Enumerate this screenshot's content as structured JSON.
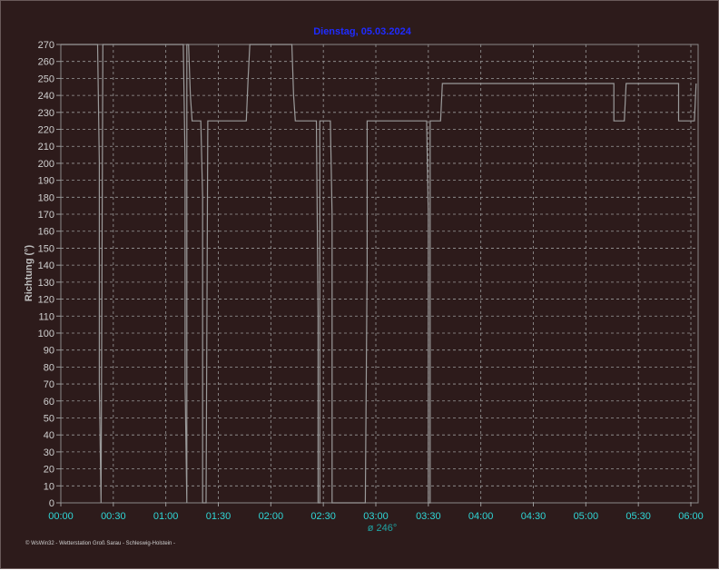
{
  "chart_data": {
    "type": "line",
    "title": "Dienstag, 05.03.2024",
    "ylabel": "Richtung  (°)",
    "ylim": [
      0,
      270
    ],
    "xlim": [
      "00:00",
      "06:00"
    ],
    "y_ticks": [
      0,
      10,
      20,
      30,
      40,
      50,
      60,
      70,
      80,
      90,
      100,
      110,
      120,
      130,
      140,
      150,
      160,
      170,
      180,
      190,
      200,
      210,
      220,
      230,
      240,
      250,
      260,
      270
    ],
    "x_ticks": [
      "00:00",
      "00:30",
      "01:00",
      "01:30",
      "02:00",
      "02:30",
      "03:00",
      "03:30",
      "04:00",
      "04:30",
      "05:00",
      "05:30",
      "06:00"
    ],
    "grid": true,
    "average_label": "ø 246°",
    "series": [
      {
        "color": "#9a9a9a",
        "x": [
          "00:00",
          "00:21",
          "00:22",
          "00:22",
          "00:23",
          "00:23",
          "00:24",
          "00:24",
          "01:10",
          "01:11",
          "01:11",
          "01:12",
          "01:12",
          "01:13",
          "01:14",
          "01:15",
          "01:15",
          "01:20",
          "01:21",
          "01:21",
          "01:22",
          "01:23",
          "01:23",
          "01:24",
          "01:24",
          "01:25",
          "01:46",
          "01:47",
          "01:48",
          "02:12",
          "02:13",
          "02:14",
          "02:26",
          "02:27",
          "02:27",
          "02:28",
          "02:28",
          "02:34",
          "02:35",
          "02:35",
          "02:54",
          "02:55",
          "02:55",
          "03:29",
          "03:30",
          "03:30",
          "03:31",
          "03:31",
          "03:36",
          "03:37",
          "03:38",
          "05:15",
          "05:16",
          "05:16",
          "05:21",
          "05:22",
          "05:23",
          "05:52",
          "05:53",
          "05:53",
          "06:02",
          "06:03"
        ],
        "y": [
          270,
          270,
          200,
          70,
          0,
          0,
          270,
          270,
          270,
          200,
          70,
          0,
          270,
          270,
          240,
          225,
          225,
          225,
          180,
          0,
          0,
          0,
          0,
          225,
          225,
          225,
          225,
          250,
          270,
          270,
          240,
          225,
          225,
          110,
          0,
          0,
          225,
          225,
          170,
          0,
          0,
          140,
          225,
          225,
          170,
          0,
          0,
          225,
          225,
          225,
          247,
          247,
          247,
          225,
          225,
          225,
          247,
          247,
          247,
          225,
          225,
          247
        ]
      }
    ],
    "footer": "© WsWin32 - Wetterstation Groß Sarau - Schleswig-Holstein -"
  }
}
